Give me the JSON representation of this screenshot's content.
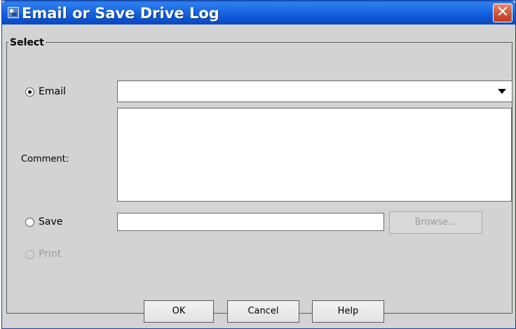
{
  "window": {
    "title": "Email or Save Drive Log",
    "close_glyph": "✕"
  },
  "group": {
    "title": "Select"
  },
  "email_option": {
    "label": "Email",
    "selected": true,
    "value": ""
  },
  "comment": {
    "label": "Comment:",
    "value": ""
  },
  "save_option": {
    "label": "Save",
    "selected": false,
    "value": "",
    "browse_label": "Browse..."
  },
  "print_option": {
    "label": "Print",
    "enabled": false
  },
  "buttons": {
    "ok": "OK",
    "cancel": "Cancel",
    "help": "Help"
  },
  "icons": {
    "app": "drive-log-icon",
    "close": "close-icon",
    "dropdown": "chevron-down-icon"
  },
  "colors": {
    "titlebar": "#0b55d4",
    "dialog_background": "#d3d3d3",
    "close_button": "#c0391c"
  }
}
